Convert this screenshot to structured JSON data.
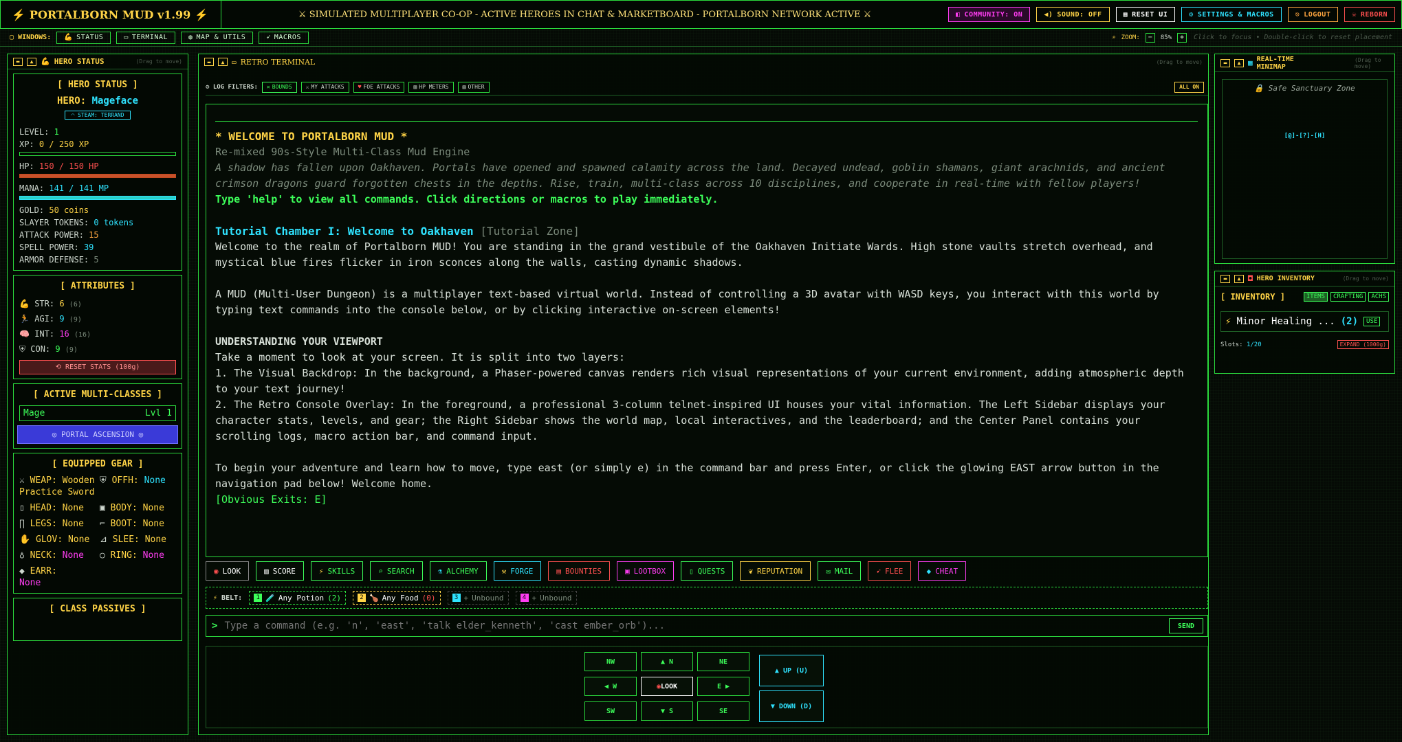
{
  "topbar": {
    "brand": "PORTALBORN MUD v1.99",
    "ticker": "SIMULATED MULTIPLAYER CO-OP - ACTIVE HEROES IN CHAT & MARKETBOARD - PORTALBORN NETWORK ACTIVE",
    "buttons": [
      {
        "label": "COMMUNITY: ON",
        "color": "#ff3df2"
      },
      {
        "label": "SOUND: OFF",
        "color": "#ffd447"
      },
      {
        "label": "RESET UI",
        "color": "#ffffff"
      },
      {
        "label": "SETTINGS & MACROS",
        "color": "#2fe3ff"
      },
      {
        "label": "LOGOUT",
        "color": "#ffa640"
      },
      {
        "label": "REBORN",
        "color": "#ff5050"
      }
    ]
  },
  "windows": {
    "label": "WINDOWS:",
    "items": [
      "STATUS",
      "TERMINAL",
      "MAP & UTILS",
      "MACROS"
    ],
    "zoom_label": "ZOOM:",
    "zoom_value": "85%",
    "hint": "Click to focus • Double-click to reset placement"
  },
  "hero": {
    "panel_title": "HERO STATUS",
    "drag": "(Drag to move)",
    "box_title": "[ HERO STATUS ]",
    "hero_label": "HERO:",
    "name": "Mageface",
    "steam": "STEAM: TERRAND",
    "level_label": "LEVEL:",
    "level": "1",
    "xp_label": "XP:",
    "xp": "0 / 250 XP",
    "xp_pct": 0,
    "hp_label": "HP:",
    "hp": "150 / 150 HP",
    "hp_pct": 100,
    "mana_label": "MANA:",
    "mana": "141 / 141 MP",
    "mana_pct": 100,
    "gold_label": "GOLD:",
    "gold": "50 coins",
    "tokens_label": "SLAYER TOKENS:",
    "tokens": "0 tokens",
    "atk_label": "ATTACK POWER:",
    "atk": "15",
    "spell_label": "SPELL POWER:",
    "spell": "39",
    "armor_label": "ARMOR DEFENSE:",
    "armor": "5"
  },
  "attributes": {
    "title": "[ ATTRIBUTES ]",
    "items": [
      {
        "k": "STR:",
        "v": "6",
        "b": "(6)",
        "color": "#ffd447"
      },
      {
        "k": "AGI:",
        "v": "9",
        "b": "(9)",
        "color": "#2fe3ff"
      },
      {
        "k": "INT:",
        "v": "16",
        "b": "(16)",
        "color": "#ff3df2"
      },
      {
        "k": "CON:",
        "v": "9",
        "b": "(9)",
        "color": "#3dff5a"
      }
    ],
    "reset": "RESET STATS (100g)"
  },
  "classes": {
    "title": "[ ACTIVE MULTI-CLASSES ]",
    "name": "Mage",
    "level": "Lvl 1",
    "ascend": "PORTAL ASCENSION"
  },
  "gear": {
    "title": "[ EQUIPPED GEAR ]",
    "items": [
      {
        "k": "WEAP:",
        "v": "Wooden Practice Sword",
        "icon": "sword-icon"
      },
      {
        "k": "OFFH:",
        "v": "None",
        "icon": "shield-icon"
      },
      {
        "k": "HEAD:",
        "v": "None",
        "icon": "helmet-icon"
      },
      {
        "k": "BODY:",
        "v": "None",
        "icon": "armor-icon"
      },
      {
        "k": "LEGS:",
        "v": "None",
        "icon": "legs-icon"
      },
      {
        "k": "BOOT:",
        "v": "None",
        "icon": "boot-icon"
      },
      {
        "k": "GLOV:",
        "v": "None",
        "icon": "glove-icon"
      },
      {
        "k": "SLEE:",
        "v": "None",
        "icon": "sleeve-icon"
      },
      {
        "k": "NECK:",
        "v": "None",
        "icon": "necklace-icon"
      },
      {
        "k": "RING:",
        "v": "None",
        "icon": "ring-icon"
      },
      {
        "k": "EARR:",
        "v": "None",
        "icon": "gem-icon"
      }
    ]
  },
  "passives": {
    "title": "[ CLASS PASSIVES ]"
  },
  "terminal": {
    "title": "RETRO TERMINAL",
    "drag": "(Drag to move)",
    "filters_label": "LOG FILTERS:",
    "filters": [
      "BOUNDS",
      "MY ATTACKS",
      "FOE ATTACKS",
      "HP METERS",
      "OTHER"
    ],
    "all_on": "ALL ON",
    "welcome": "* WELCOME TO PORTALBORN MUD *",
    "subtitle": "Re-mixed 90s-Style Multi-Class Mud Engine",
    "lore": "A shadow has fallen upon Oakhaven. Portals have opened and spawned calamity across the land. Decayed undead, goblin shamans, giant arachnids, and ancient crimson dragons guard forgotten chests in the depths. Rise, train, multi-class across 10 disciplines, and cooperate in real-time with fellow players!",
    "help": "Type 'help' to view all commands. Click directions or macros to play immediately.",
    "room": "Tutorial Chamber I: Welcome to Oakhaven",
    "zone": "[Tutorial Zone]",
    "p1": "Welcome to the realm of Portalborn MUD! You are standing in the grand vestibule of the Oakhaven Initiate Wards. High stone vaults stretch overhead, and mystical blue fires flicker in iron sconces along the walls, casting dynamic shadows.",
    "p2": "A MUD (Multi-User Dungeon) is a multiplayer text-based virtual world. Instead of controlling a 3D avatar with WASD keys, you interact with this world by typing text commands into the console below, or by clicking interactive on-screen elements!",
    "h2": "UNDERSTANDING YOUR VIEWPORT",
    "p3": "Take a moment to look at your screen. It is split into two layers:",
    "p4": "1. The Visual Backdrop: In the background, a Phaser-powered canvas renders rich visual representations of your current environment, adding atmospheric depth to your text journey!",
    "p5": "2. The Retro Console Overlay: In the foreground, a professional 3-column telnet-inspired UI houses your vital information. The Left Sidebar displays your character stats, levels, and gear; the Right Sidebar shows the world map, local interactives, and the leaderboard; and the Center Panel contains your scrolling logs, macro action bar, and command input.",
    "p6": "To begin your adventure and learn how to move, type east (or simply e) in the command bar and press Enter, or click the glowing EAST arrow button in the navigation pad below! Welcome home.",
    "exits": "[Obvious Exits: E]",
    "commands": [
      {
        "label": "LOOK",
        "color": "#ffffff"
      },
      {
        "label": "SCORE",
        "color": "#ffffff"
      },
      {
        "label": "SKILLS",
        "color": "#3dff5a"
      },
      {
        "label": "SEARCH",
        "color": "#3dff5a"
      },
      {
        "label": "ALCHEMY",
        "color": "#3dff5a"
      },
      {
        "label": "FORGE",
        "color": "#2fe3ff"
      },
      {
        "label": "BOUNTIES",
        "color": "#ff5050"
      },
      {
        "label": "LOOTBOX",
        "color": "#ff3df2"
      },
      {
        "label": "QUESTS",
        "color": "#3dff5a"
      },
      {
        "label": "REPUTATION",
        "color": "#ffd447"
      },
      {
        "label": "MAIL",
        "color": "#3dff5a"
      },
      {
        "label": "FLEE",
        "color": "#ff5050"
      },
      {
        "label": "CHEAT",
        "color": "#ff3df2"
      }
    ],
    "belt_label": "BELT:",
    "belt": [
      {
        "n": "1",
        "label": "Any Potion",
        "count": "(2)",
        "color": "#3dff5a"
      },
      {
        "n": "2",
        "label": "Any Food",
        "count": "(0)",
        "color": "#ffd447"
      },
      {
        "n": "3",
        "label": "Unbound",
        "count": "",
        "color": "#2fe3ff"
      },
      {
        "n": "4",
        "label": "Unbound",
        "count": "",
        "color": "#ff3df2"
      }
    ],
    "prompt": ">",
    "placeholder": "Type a command (e.g. 'n', 'east', 'talk elder_kenneth', 'cast ember_orb')...",
    "send": "SEND",
    "nav": {
      "nw": "NW",
      "n": "▲ N",
      "ne": "NE",
      "w": "◀ W",
      "look": "LOOK",
      "e": "E ▶",
      "sw": "SW",
      "s": "▼ S",
      "se": "SE",
      "up": "▲ UP (U)",
      "down": "▼ DOWN (D)"
    }
  },
  "minimap": {
    "title": "REAL-TIME MINIMAP",
    "drag": "(Drag to move)",
    "zone": "Safe Sanctuary Zone",
    "rooms": "[@]-[?]-[H]"
  },
  "inventory": {
    "title": "HERO INVENTORY",
    "drag": "(Drag to move)",
    "label": "[ INVENTORY ]",
    "tabs": [
      "ITEMS",
      "CRAFTING",
      "ACHS"
    ],
    "item": "Minor Healing ...",
    "count": "(2)",
    "use": "USE",
    "slots_label": "Slots:",
    "slots": "1/20",
    "expand": "EXPAND (1000g)"
  }
}
